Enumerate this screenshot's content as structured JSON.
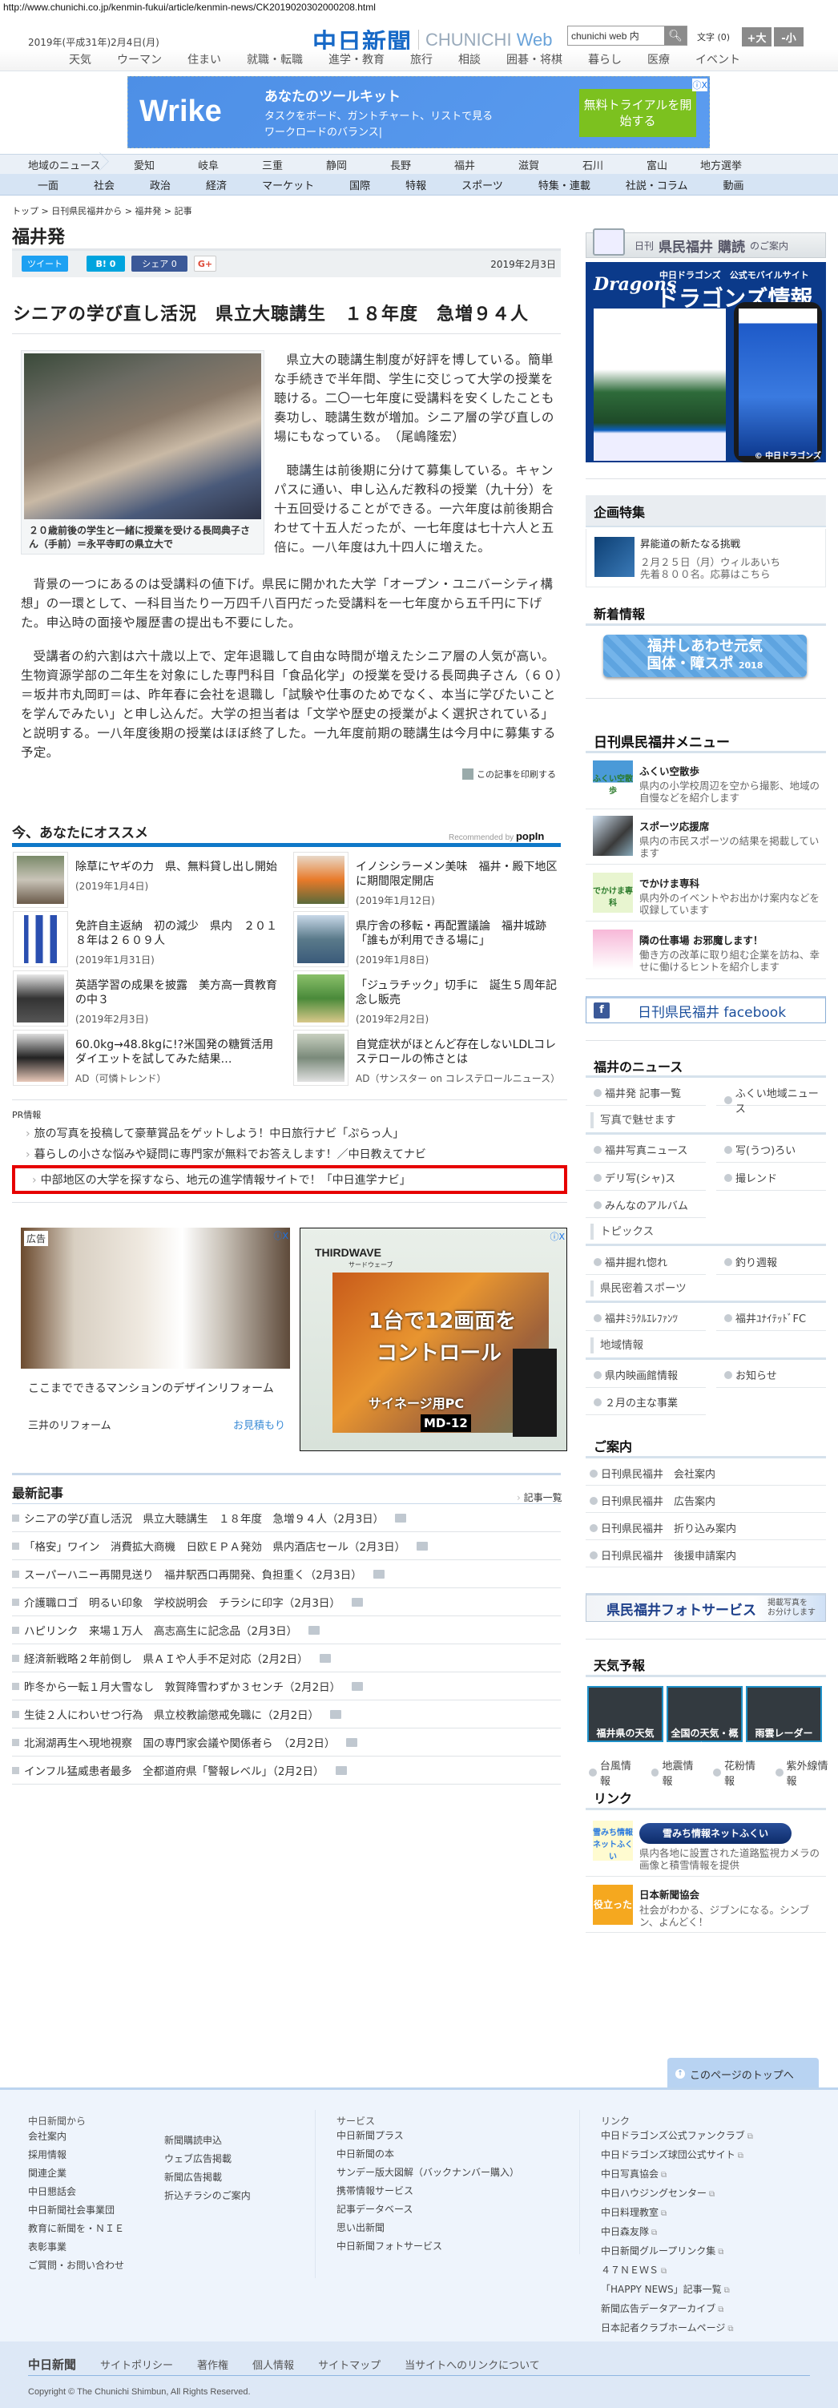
{
  "browser": {
    "url": "http://www.chunichi.co.jp/kenmin-fukui/article/kenmin-news/CK2019020302000208.html"
  },
  "header": {
    "date": "2019年(平成31年)2月4日(月)",
    "logo_jp": "中日新聞",
    "logo_en_a": "CHUNICHI",
    "logo_en_b": "Web",
    "search_value": "chunichi web 内",
    "font_label": "文字",
    "font_count": "(0)",
    "font_larger": "+大",
    "font_smaller": "-小"
  },
  "top_nav": [
    "天気",
    "ウーマン",
    "住まい",
    "就職・転職",
    "進学・教育",
    "旅行",
    "相談",
    "囲碁・将棋",
    "暮らし",
    "医療",
    "イベント"
  ],
  "top_ad": {
    "brand": "Wrike",
    "headline": "あなたのツールキット",
    "line1": "タスクをボード、ガントチャート、リストで見る",
    "line2": "ワークロードのバランス|",
    "cta": "無料トライアルを開始する",
    "close": "ⓘX"
  },
  "region_nav": {
    "label": "地域のニュース",
    "items": [
      "愛知",
      "岐阜",
      "三重",
      "静岡",
      "長野",
      "福井",
      "滋賀",
      "石川",
      "富山",
      "地方選挙"
    ]
  },
  "category_nav": [
    "一面",
    "社会",
    "政治",
    "経済",
    "マーケット",
    "国際",
    "特報",
    "スポーツ",
    "特集・連載",
    "社説・コラム",
    "動画"
  ],
  "breadcrumb": "トップ > 日刊県民福井から > 福井発 > 記事",
  "section_title": "福井発",
  "share": {
    "tweet": "ツイート",
    "hatena": "B! 0",
    "facebook": "シェア 0",
    "gplus": "G+",
    "date": "2019年2月3日"
  },
  "article": {
    "headline": "シニアの学び直し活況　県立大聴講生　１８年度　急増９４人",
    "caption": "２０歳前後の学生と一緒に授業を受ける長岡典子さん（手前）＝永平寺町の県立大で",
    "paragraphs": [
      "県立大の聴講生制度が好評を博している。簡単な手続きで半年間、学生に交じって大学の授業を聴ける。二〇一七年度に受講料を安くしたことも奏功し、聴講生数が増加。シニア層の学び直しの場にもなっている。　（尾嶋隆宏）",
      "聴講生は前後期に分けて募集している。キャンパスに通い、申し込んだ教科の授業（九十分）を十五回受けることができる。一六年度は前後期合わせて十五人だったが、一七年度は七十六人と五倍に。一八年度は九十四人に増えた。",
      "背景の一つにあるのは受講料の値下げ。県民に開かれた大学「オープン・ユニバーシティ構想」の一環として、一科目当たり一万四千八百円だった受講料を一七年度から五千円に下げた。申込時の面接や履歴書の提出も不要にした。",
      "受講者の約六割は六十歳以上で、定年退職して自由な時間が増えたシニア層の人気が高い。生物資源学部の二年生を対象にした専門科目「食品化学」の授業を受ける長岡典子さん（６０）＝坂井市丸岡町＝は、昨年春に会社を退職し「試験や仕事のためでなく、本当に学びたいことを学んでみたい」と申し込んだ。大学の担当者は「文学や歴史の授業がよく選択されている」と説明する。一八年度後期の授業はほぼ終了した。一九年度前期の聴講生は今月中に募集する予定。"
    ],
    "print_label": "この記事を印刷する"
  },
  "recommend": {
    "title": "今、あなたにオススメ",
    "powered": "Recommended by",
    "powered_brand": "popIn",
    "items": [
      {
        "title": "除草にヤギの力　県、無料貸し出し開始",
        "meta": "(2019年1月4日)"
      },
      {
        "title": "イノシシラーメン美味　福井・殿下地区に期間限定開店",
        "meta": "(2019年1月12日)"
      },
      {
        "title": "免許自主返納　初の減少　県内　２０１８年は２６０９人",
        "meta": "(2019年1月31日)"
      },
      {
        "title": "県庁舎の移転・再配置議論　福井城跡「誰もが利用できる場に」",
        "meta": "(2019年1月8日)"
      },
      {
        "title": "英語学習の成果を披露　美方高一貫教育の中３",
        "meta": "(2019年2月3日)"
      },
      {
        "title": "「ジュラチック」切手に　誕生５周年記念し販売",
        "meta": "(2019年2月2日)"
      },
      {
        "title": "60.0kg→48.8kgに!?米国発の糖質活用ダイエットを試してみた結果…",
        "meta": "AD（可憐トレンド）"
      },
      {
        "title": "自覚症状がほとんど存在しないLDLコレステロールの怖さとは",
        "meta": "AD（サンスター on コレステロールニュース）"
      }
    ]
  },
  "pr": {
    "label": "PR情報",
    "links": [
      "旅の写真を投稿して豪華賞品をゲットしよう！中日旅行ナビ「ぷらっ人」",
      "暮らしの小さな悩みや疑問に専門家が無料でお答えします！／中日教えてナビ",
      "中部地区の大学を探すなら、地元の進学情報サイトで！「中日進学ナビ」"
    ]
  },
  "ads": {
    "left": {
      "badge": "広告",
      "caption": "ここまでできるマンションのデザインリフォーム",
      "advertiser": "三井のリフォーム",
      "cta": "お見積もり",
      "close": "ⓘX"
    },
    "right": {
      "brand": "THIRDWAVE",
      "brand_kana": "サードウェーブ",
      "headline1": "1台で12画面を",
      "headline2": "コントロール",
      "sub": "サイネージ用PC",
      "model": "MD-12",
      "close": "ⓘX"
    }
  },
  "latest": {
    "title": "最新記事",
    "more": "記事一覧",
    "items": [
      "シニアの学び直し活況　県立大聴講生　１８年度　急増９４人（2月3日）",
      "「格安」ワイン　消費拡大商機　日欧ＥＰＡ発効　県内酒店セール（2月3日）",
      "スーパーハニー再開見送り　福井駅西口再開発、負担重く（2月3日）",
      "介護職ロゴ　明るい印象　学校説明会　チラシに印字（2月3日）",
      "ハピリンク　来場１万人　高志高生に記念品（2月3日）",
      "経済新戦略２年前倒し　県ＡＩや人手不足対応（2月2日）",
      "昨冬から一転１月大雪なし　敦賀降雪わずか３センチ（2月2日）",
      "生徒２人にわいせつ行為　県立校教諭懲戒免職に（2月2日）",
      "北潟湖再生へ現地視察　国の専門家会議や関係者ら　（2月2日）",
      "インフル猛威患者最多　全都道府県「警報レベル」（2月2日）"
    ]
  },
  "sidebar": {
    "subscribe_banner": {
      "small": "日刊",
      "main": "県民福井",
      "action": "購読",
      "tail": "のご案内"
    },
    "dragons_banner": {
      "logo": "Dragons",
      "sub": "中日ドラゴンズ　公式モバイルサイト",
      "title": "ドラゴンズ情報",
      "copyright": "© 中日ドラゴンズ"
    },
    "feature": {
      "title": "企画特集",
      "item_title": "昇能道の新たなる挑戦",
      "item_desc1": "２月２５日（月）ウィルあいち",
      "item_desc2": "先着８００名。応募はこちら"
    },
    "news_info": {
      "title": "新着情報",
      "banner1": "福井しあわせ元気",
      "banner2": "国体・障スポ",
      "banner_year": "2018"
    },
    "menu": {
      "title": "日刊県民福井メニュー",
      "items": [
        {
          "title": "ふくい空散歩",
          "desc": "県内の小学校周辺を空から撮影、地域の自慢などを紹介します",
          "thumb": "ふくい空散歩"
        },
        {
          "title": "スポーツ応援席",
          "desc": "県内の市民スポーツの結果を掲載しています",
          "thumb": ""
        },
        {
          "title": "でかけま専科",
          "desc": "県内外のイベントやお出かけ案内などを収録しています",
          "thumb": "でかけま専科"
        },
        {
          "title": "隣の仕事場 お邪魔します！",
          "desc": "働き方の改革に取り組む企業を訪ね、幸せに働けるヒントを紹介します",
          "thumb": ""
        }
      ]
    },
    "facebook": "日刊県民福井 facebook",
    "fukui_news": {
      "title": "福井のニュース",
      "links": [
        "福井発 記事一覧",
        "ふくい地域ニュース"
      ],
      "photo_title": "写真で魅せます",
      "photo_links": [
        "福井写真ニュース",
        "写(うつ)ろい",
        "デリ写(シャ)ス",
        "撮レンド",
        "みんなのアルバム"
      ],
      "topics_title": "トピックス",
      "topics_links": [
        "福井掘れ惚れ",
        "釣り週報"
      ],
      "sports_title": "県民密着スポーツ",
      "sports_links": [
        "福井ﾐﾗｸﾙｴﾚﾌｧﾝﾂ",
        "福井ﾕﾅｲﾃｯﾄﾞFC"
      ],
      "local_title": "地域情報",
      "local_links": [
        "県内映画館情報",
        "お知らせ",
        "２月の主な事業"
      ]
    },
    "guide": {
      "title": "ご案内",
      "links": [
        "日刊県民福井　会社案内",
        "日刊県民福井　広告案内",
        "日刊県民福井　折り込み案内",
        "日刊県民福井　後援申請案内"
      ]
    },
    "photo_service": {
      "title": "県民福井フォトサービス",
      "sub1": "掲載写真を",
      "sub2": "お分けします"
    },
    "weather": {
      "title": "天気予報",
      "tiles": [
        "福井県の天気",
        "全国の天気・概況",
        "雨雲レーダー"
      ],
      "links": [
        "台風情報",
        "地震情報",
        "花粉情報",
        "紫外線情報"
      ]
    },
    "links": {
      "title": "リンク",
      "items": [
        {
          "title": "雪みち情報ネットふくい",
          "desc": "県内各地に設置された道路監視カメラの画像と積雪情報を提供",
          "thumb": "雪みち情報ネットふくい"
        },
        {
          "title": "日本新聞協会",
          "desc": "社会がわかる、ジブンになる。シンブン、よんどく！",
          "thumb": "役立った"
        }
      ]
    }
  },
  "footer": {
    "back_to_top": "このページのトップへ",
    "col1_title": "中日新聞から",
    "col1a": [
      "会社案内",
      "採用情報",
      "関連企業",
      "中日懇話会",
      "中日新聞社会事業団",
      "教育に新聞を・ＮＩＥ",
      "表彰事業",
      "ご質問・お問い合わせ"
    ],
    "col1b": [
      "新聞購読申込",
      "ウェブ広告掲載",
      "新聞広告掲載",
      "折込チラシのご案内"
    ],
    "col2_title": "サービス",
    "col2": [
      "中日新聞プラス",
      "中日新聞の本",
      "サンデー版大図解（バックナンバー購入）",
      "携帯情報サービス",
      "記事データベース",
      "思い出新聞",
      "中日新聞フォトサービス"
    ],
    "col3_title": "リンク",
    "col3": [
      "中日ドラゴンズ公式ファンクラブ",
      "中日ドラゴンズ球団公式サイト",
      "中日写真協会",
      "中日ハウジングセンター",
      "中日料理教室",
      "中日森友隊",
      "中日新聞グループリンク集",
      "４７ＮＥＷＳ",
      "「HAPPY NEWS」記事一覧",
      "新聞広告データアーカイブ",
      "日本記者クラブホームページ"
    ],
    "bar_logo": "中日新聞",
    "bar_links": [
      "サイトポリシー",
      "著作権",
      "個人情報",
      "サイトマップ",
      "当サイトへのリンクについて"
    ],
    "copyright": "Copyright © The Chunichi Shimbun, All Rights Reserved."
  }
}
